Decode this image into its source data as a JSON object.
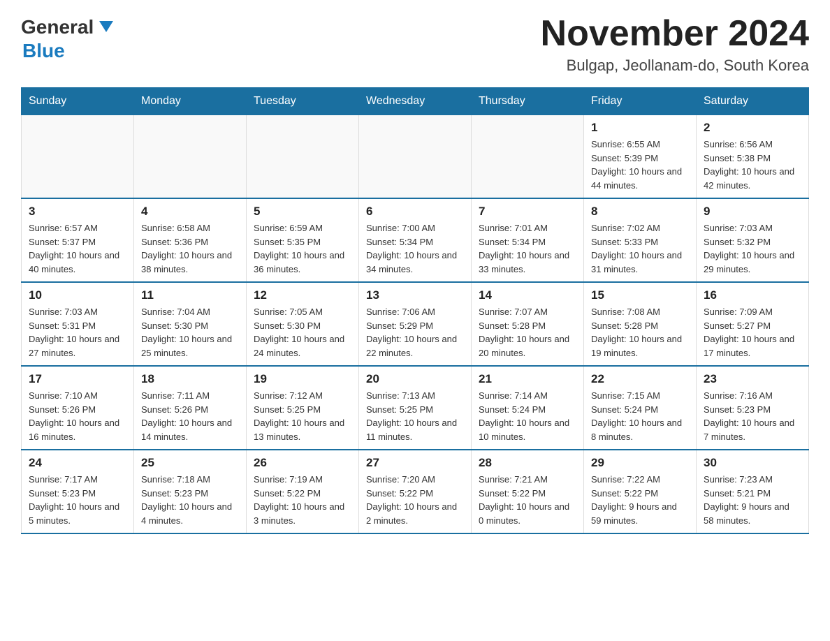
{
  "header": {
    "logo_general": "General",
    "logo_blue": "Blue",
    "title": "November 2024",
    "subtitle": "Bulgap, Jeollanam-do, South Korea"
  },
  "days_of_week": [
    "Sunday",
    "Monday",
    "Tuesday",
    "Wednesday",
    "Thursday",
    "Friday",
    "Saturday"
  ],
  "weeks": [
    [
      {
        "day": "",
        "info": ""
      },
      {
        "day": "",
        "info": ""
      },
      {
        "day": "",
        "info": ""
      },
      {
        "day": "",
        "info": ""
      },
      {
        "day": "",
        "info": ""
      },
      {
        "day": "1",
        "info": "Sunrise: 6:55 AM\nSunset: 5:39 PM\nDaylight: 10 hours and 44 minutes."
      },
      {
        "day": "2",
        "info": "Sunrise: 6:56 AM\nSunset: 5:38 PM\nDaylight: 10 hours and 42 minutes."
      }
    ],
    [
      {
        "day": "3",
        "info": "Sunrise: 6:57 AM\nSunset: 5:37 PM\nDaylight: 10 hours and 40 minutes."
      },
      {
        "day": "4",
        "info": "Sunrise: 6:58 AM\nSunset: 5:36 PM\nDaylight: 10 hours and 38 minutes."
      },
      {
        "day": "5",
        "info": "Sunrise: 6:59 AM\nSunset: 5:35 PM\nDaylight: 10 hours and 36 minutes."
      },
      {
        "day": "6",
        "info": "Sunrise: 7:00 AM\nSunset: 5:34 PM\nDaylight: 10 hours and 34 minutes."
      },
      {
        "day": "7",
        "info": "Sunrise: 7:01 AM\nSunset: 5:34 PM\nDaylight: 10 hours and 33 minutes."
      },
      {
        "day": "8",
        "info": "Sunrise: 7:02 AM\nSunset: 5:33 PM\nDaylight: 10 hours and 31 minutes."
      },
      {
        "day": "9",
        "info": "Sunrise: 7:03 AM\nSunset: 5:32 PM\nDaylight: 10 hours and 29 minutes."
      }
    ],
    [
      {
        "day": "10",
        "info": "Sunrise: 7:03 AM\nSunset: 5:31 PM\nDaylight: 10 hours and 27 minutes."
      },
      {
        "day": "11",
        "info": "Sunrise: 7:04 AM\nSunset: 5:30 PM\nDaylight: 10 hours and 25 minutes."
      },
      {
        "day": "12",
        "info": "Sunrise: 7:05 AM\nSunset: 5:30 PM\nDaylight: 10 hours and 24 minutes."
      },
      {
        "day": "13",
        "info": "Sunrise: 7:06 AM\nSunset: 5:29 PM\nDaylight: 10 hours and 22 minutes."
      },
      {
        "day": "14",
        "info": "Sunrise: 7:07 AM\nSunset: 5:28 PM\nDaylight: 10 hours and 20 minutes."
      },
      {
        "day": "15",
        "info": "Sunrise: 7:08 AM\nSunset: 5:28 PM\nDaylight: 10 hours and 19 minutes."
      },
      {
        "day": "16",
        "info": "Sunrise: 7:09 AM\nSunset: 5:27 PM\nDaylight: 10 hours and 17 minutes."
      }
    ],
    [
      {
        "day": "17",
        "info": "Sunrise: 7:10 AM\nSunset: 5:26 PM\nDaylight: 10 hours and 16 minutes."
      },
      {
        "day": "18",
        "info": "Sunrise: 7:11 AM\nSunset: 5:26 PM\nDaylight: 10 hours and 14 minutes."
      },
      {
        "day": "19",
        "info": "Sunrise: 7:12 AM\nSunset: 5:25 PM\nDaylight: 10 hours and 13 minutes."
      },
      {
        "day": "20",
        "info": "Sunrise: 7:13 AM\nSunset: 5:25 PM\nDaylight: 10 hours and 11 minutes."
      },
      {
        "day": "21",
        "info": "Sunrise: 7:14 AM\nSunset: 5:24 PM\nDaylight: 10 hours and 10 minutes."
      },
      {
        "day": "22",
        "info": "Sunrise: 7:15 AM\nSunset: 5:24 PM\nDaylight: 10 hours and 8 minutes."
      },
      {
        "day": "23",
        "info": "Sunrise: 7:16 AM\nSunset: 5:23 PM\nDaylight: 10 hours and 7 minutes."
      }
    ],
    [
      {
        "day": "24",
        "info": "Sunrise: 7:17 AM\nSunset: 5:23 PM\nDaylight: 10 hours and 5 minutes."
      },
      {
        "day": "25",
        "info": "Sunrise: 7:18 AM\nSunset: 5:23 PM\nDaylight: 10 hours and 4 minutes."
      },
      {
        "day": "26",
        "info": "Sunrise: 7:19 AM\nSunset: 5:22 PM\nDaylight: 10 hours and 3 minutes."
      },
      {
        "day": "27",
        "info": "Sunrise: 7:20 AM\nSunset: 5:22 PM\nDaylight: 10 hours and 2 minutes."
      },
      {
        "day": "28",
        "info": "Sunrise: 7:21 AM\nSunset: 5:22 PM\nDaylight: 10 hours and 0 minutes."
      },
      {
        "day": "29",
        "info": "Sunrise: 7:22 AM\nSunset: 5:22 PM\nDaylight: 9 hours and 59 minutes."
      },
      {
        "day": "30",
        "info": "Sunrise: 7:23 AM\nSunset: 5:21 PM\nDaylight: 9 hours and 58 minutes."
      }
    ]
  ]
}
